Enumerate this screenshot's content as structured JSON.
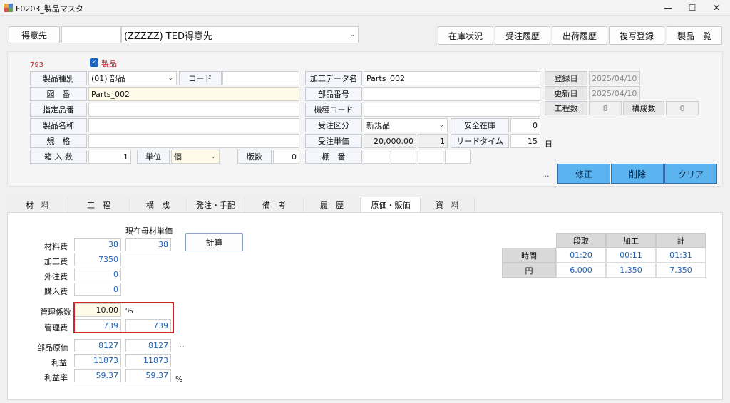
{
  "window": {
    "title": "F0203_製品マスタ",
    "minimize": "—",
    "maximize": "☐",
    "close": "✕"
  },
  "toolbar": {
    "customer_label": "得意先",
    "customer_code": "",
    "customer_select": "(ZZZZZ) TED得意先",
    "buttons": [
      "在庫状況",
      "受注履歴",
      "出荷履歴",
      "複写登録",
      "製品一覧"
    ]
  },
  "header": {
    "record_no": "793",
    "product_checkbox_label": "製品",
    "product_checked": true
  },
  "form_left": {
    "product_type_label": "製品種別",
    "product_type_value": "(01) 部品",
    "code_label": "コード",
    "code_value": "",
    "drawing_no_label": "図　番",
    "drawing_no_value": "Parts_002",
    "designated_no_label": "指定品番",
    "designated_no_value": "",
    "product_name_label": "製品名称",
    "product_name_value": "",
    "spec_label": "規　格",
    "spec_value": "",
    "box_qty_label": "箱 入 数",
    "box_qty_value": "1",
    "unit_label": "単位",
    "unit_value": "個",
    "revision_label": "版数",
    "revision_value": "0"
  },
  "form_mid": {
    "process_data_label": "加工データ名",
    "process_data_value": "Parts_002",
    "part_no_label": "部品番号",
    "part_no_value": "",
    "model_code_label": "機種コード",
    "model_code_value": "",
    "order_type_label": "受注区分",
    "order_type_value": "新規品",
    "safety_stock_label": "安全在庫",
    "safety_stock_value": "0",
    "unit_price_label": "受注単価",
    "unit_price_value": "20,000.00",
    "unit_price_qty": "1",
    "lead_time_label": "リードタイム",
    "lead_time_value": "15",
    "lead_time_unit": "日",
    "shelf_label": "棚　番"
  },
  "form_right": {
    "registered_label": "登録日",
    "registered_value": "2025/04/10",
    "updated_label": "更新日",
    "updated_value": "2025/04/10",
    "process_count_label": "工程数",
    "process_count_value": "8",
    "component_count_label": "構成数",
    "component_count_value": "0"
  },
  "actions": {
    "ellipsis": "...",
    "modify": "修正",
    "delete": "削除",
    "clear": "クリア"
  },
  "tabs": [
    "材　料",
    "工　程",
    "構　成",
    "発注・手配",
    "備　考",
    "履　歴",
    "原価・販価",
    "資　料"
  ],
  "active_tab": 6,
  "cost": {
    "current_material_label": "現在母材単価",
    "material_label": "材料費",
    "material_value": "38",
    "material_current": "38",
    "processing_label": "加工費",
    "processing_value": "7350",
    "outsourcing_label": "外注費",
    "outsourcing_value": "0",
    "purchase_label": "購入費",
    "purchase_value": "0",
    "calc_button": "計算",
    "mgmt_coef_label": "管理係数",
    "mgmt_coef_value": "10.00",
    "mgmt_coef_unit": "%",
    "mgmt_fee_label": "管理費",
    "mgmt_fee_value": "739",
    "mgmt_fee_value2": "739",
    "part_cost_label": "部品原価",
    "part_cost_value": "8127",
    "part_cost_value2": "8127",
    "part_cost_ellipsis": "…",
    "profit_label": "利益",
    "profit_value": "11873",
    "profit_value2": "11873",
    "profit_rate_label": "利益率",
    "profit_rate_value": "59.37",
    "profit_rate_value2": "59.37",
    "profit_rate_unit": "%"
  },
  "summary_grid": {
    "headers": [
      "段取",
      "加工",
      "計"
    ],
    "rows": [
      {
        "label": "時間",
        "values": [
          "01:20",
          "00:11",
          "01:31"
        ]
      },
      {
        "label": "円",
        "values": [
          "6,000",
          "1,350",
          "7,350"
        ]
      }
    ]
  },
  "colors": {
    "highlight_box": "#d1232a",
    "action_button": "#5bb4f0",
    "link_blue": "#1f64b8",
    "record_no": "#c0282d"
  }
}
